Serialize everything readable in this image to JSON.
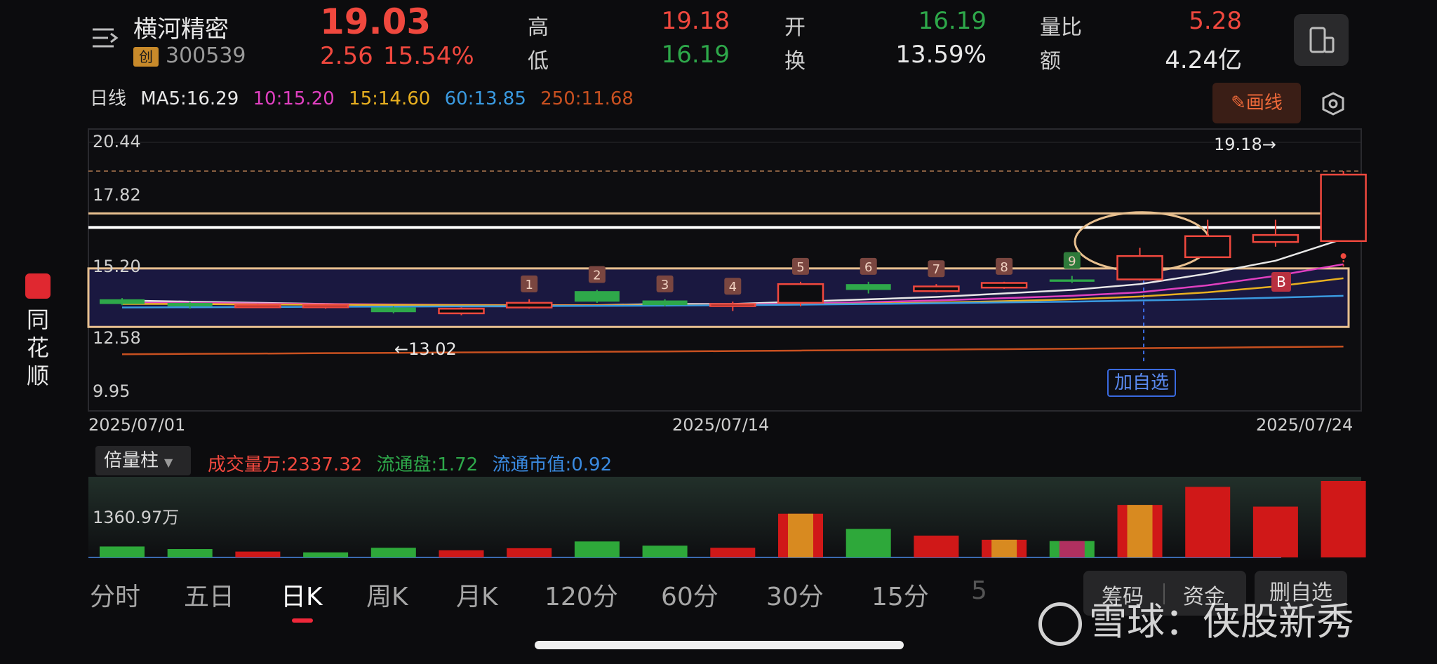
{
  "header": {
    "menu_icon": "menu-icon",
    "stock_name": "横河精密",
    "board_badge": "创",
    "stock_code": "300539",
    "price": "19.03",
    "change": "2.56",
    "change_pct": "15.54%",
    "high_label": "高",
    "high_value": "19.18",
    "low_label": "低",
    "low_value": "16.19",
    "open_label": "开",
    "open_value": "16.19",
    "turnover_label": "换",
    "turnover_value": "13.59%",
    "volume_ratio_label": "量比",
    "volume_ratio_value": "5.28",
    "amount_label": "额",
    "amount_value": "4.24亿",
    "device_icon": "phone-landscape-icon"
  },
  "ma_bar": {
    "period": "日线",
    "ma5": "MA5:16.29",
    "ma10": "10:15.20",
    "ma15": "15:14.60",
    "ma60": "60:13.85",
    "ma250": "250:11.68",
    "draw_button": "画线",
    "settings_icon": "hexagon-settings-icon"
  },
  "chart_labels": {
    "y_ticks": [
      "20.44",
      "17.82",
      "15.20",
      "12.58",
      "9.95"
    ],
    "x_dates": [
      "2025/07/01",
      "2025/07/14",
      "2025/07/24"
    ],
    "high_marker": "19.18→",
    "low_marker": "←13.02",
    "add_watchlist": "加自选",
    "buy_signal": "B",
    "numbered_markers": [
      "1",
      "2",
      "3",
      "4",
      "5",
      "6",
      "7",
      "8",
      "9"
    ]
  },
  "volume_bar": {
    "mode": "倍量柱",
    "volume": "成交量万:2337.32",
    "float_shares": "流通盘:1.72",
    "float_value": "流通市值:0.92",
    "y_label": "1360.97万"
  },
  "tabs": [
    "分时",
    "五日",
    "日K",
    "周K",
    "月K",
    "120分",
    "60分",
    "30分",
    "15分",
    "5"
  ],
  "bottom_buttons": {
    "chips": "筹码",
    "funds": "资金",
    "delete_watch": "删自选"
  },
  "side_brand": [
    "同",
    "花",
    "顺"
  ],
  "watermark": "雪球：侠股新秀",
  "chart_data": {
    "type": "candlestick",
    "dates_start": "2025/07/01",
    "dates_mid": "2025/07/14",
    "dates_end": "2025/07/24",
    "ylim": [
      9.95,
      20.44
    ],
    "y_ticks": [
      20.44,
      17.82,
      15.2,
      12.58,
      9.95
    ],
    "candles": [
      {
        "o": 13.7,
        "c": 13.5,
        "h": 13.75,
        "l": 13.45
      },
      {
        "o": 13.55,
        "c": 13.4,
        "h": 13.6,
        "l": 13.3
      },
      {
        "o": 13.4,
        "c": 13.45,
        "h": 13.5,
        "l": 13.35
      },
      {
        "o": 13.4,
        "c": 13.45,
        "h": 13.5,
        "l": 13.3
      },
      {
        "o": 13.35,
        "c": 13.15,
        "h": 13.4,
        "l": 13.1
      },
      {
        "o": 13.1,
        "c": 13.3,
        "h": 13.35,
        "l": 13.02
      },
      {
        "o": 13.35,
        "c": 13.55,
        "h": 13.7,
        "l": 13.3
      },
      {
        "o": 14.05,
        "c": 13.6,
        "h": 14.1,
        "l": 13.55
      },
      {
        "o": 13.65,
        "c": 13.45,
        "h": 13.7,
        "l": 13.4
      },
      {
        "o": 13.45,
        "c": 13.5,
        "h": 13.6,
        "l": 13.2
      },
      {
        "o": 13.55,
        "c": 14.35,
        "h": 14.45,
        "l": 13.4
      },
      {
        "o": 14.35,
        "c": 14.1,
        "h": 14.45,
        "l": 13.95
      },
      {
        "o": 14.05,
        "c": 14.25,
        "h": 14.35,
        "l": 14.0
      },
      {
        "o": 14.2,
        "c": 14.4,
        "h": 14.45,
        "l": 14.15
      },
      {
        "o": 14.55,
        "c": 14.45,
        "h": 14.7,
        "l": 14.4
      },
      {
        "o": 14.55,
        "c": 15.55,
        "h": 15.9,
        "l": 14.5
      },
      {
        "o": 15.5,
        "c": 16.4,
        "h": 17.1,
        "l": 15.5
      },
      {
        "o": 16.15,
        "c": 16.45,
        "h": 17.1,
        "l": 15.95
      },
      {
        "o": 16.19,
        "c": 19.03,
        "h": 19.18,
        "l": 16.19
      }
    ],
    "ma_lines": [
      {
        "name": "MA5",
        "values": [
          13.65,
          13.6,
          13.55,
          13.5,
          13.45,
          13.4,
          13.4,
          13.45,
          13.5,
          13.5,
          13.6,
          13.7,
          13.8,
          13.95,
          14.1,
          14.35,
          14.8,
          15.35,
          16.29
        ]
      },
      {
        "name": "10",
        "values": [
          13.55,
          13.55,
          13.52,
          13.5,
          13.48,
          13.46,
          13.45,
          13.45,
          13.45,
          13.48,
          13.52,
          13.58,
          13.65,
          13.75,
          13.85,
          14.0,
          14.3,
          14.7,
          15.2
        ]
      },
      {
        "name": "15",
        "values": [
          13.5,
          13.5,
          13.48,
          13.47,
          13.46,
          13.45,
          13.44,
          13.44,
          13.45,
          13.46,
          13.48,
          13.52,
          13.56,
          13.62,
          13.7,
          13.82,
          14.0,
          14.25,
          14.6
        ]
      },
      {
        "name": "60",
        "values": [
          13.35,
          13.36,
          13.37,
          13.38,
          13.39,
          13.4,
          13.41,
          13.42,
          13.43,
          13.45,
          13.47,
          13.5,
          13.53,
          13.57,
          13.6,
          13.65,
          13.7,
          13.77,
          13.85
        ]
      },
      {
        "name": "250",
        "values": [
          11.35,
          11.37,
          11.38,
          11.4,
          11.41,
          11.43,
          11.44,
          11.46,
          11.47,
          11.49,
          11.51,
          11.53,
          11.55,
          11.57,
          11.59,
          11.61,
          11.63,
          11.66,
          11.68
        ]
      }
    ],
    "volumes": [
      {
        "v": 260,
        "color": "green"
      },
      {
        "v": 200,
        "color": "green"
      },
      {
        "v": 140,
        "color": "red"
      },
      {
        "v": 120,
        "color": "green"
      },
      {
        "v": 230,
        "color": "green"
      },
      {
        "v": 170,
        "color": "red"
      },
      {
        "v": 220,
        "color": "red"
      },
      {
        "v": 380,
        "color": "green"
      },
      {
        "v": 280,
        "color": "green"
      },
      {
        "v": 230,
        "color": "red"
      },
      {
        "v": 1040,
        "color": "red",
        "double": true
      },
      {
        "v": 680,
        "color": "green"
      },
      {
        "v": 520,
        "color": "red"
      },
      {
        "v": 420,
        "color": "red",
        "double": true
      },
      {
        "v": 390,
        "color": "green",
        "double": true
      },
      {
        "v": 1250,
        "color": "red",
        "double": true
      },
      {
        "v": 1680,
        "color": "red"
      },
      {
        "v": 1210,
        "color": "red"
      },
      {
        "v": 1820,
        "color": "red"
      }
    ]
  }
}
